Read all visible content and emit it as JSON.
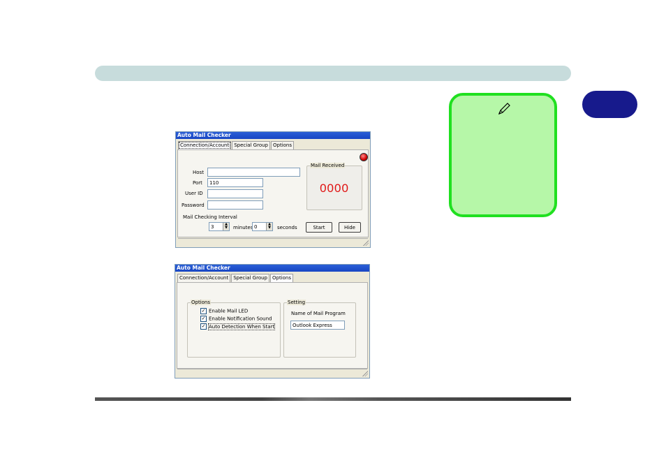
{
  "page": {
    "chapter_number": ""
  },
  "window1": {
    "title": "Auto Mail Checker",
    "tabs": [
      "Connection/Account",
      "Special Group",
      "Options"
    ],
    "host_label": "Host",
    "host_value": "",
    "port_label": "Port",
    "port_value": "110",
    "userid_label": "User ID",
    "userid_value": "",
    "password_label": "Password",
    "password_value": "",
    "mail_received_label": "Mail Received",
    "mail_count": "0000",
    "interval_label": "Mail Checking Interval",
    "minutes_value": "3",
    "minutes_label": "minutes",
    "seconds_value": "0",
    "seconds_label": "seconds",
    "start_button": "Start",
    "hide_button": "Hide"
  },
  "window2": {
    "title": "Auto Mail Checker",
    "tabs": [
      "Connection/Account",
      "Special Group",
      "Options"
    ],
    "options_group": "Options",
    "options": [
      {
        "label": "Enable Mail LED",
        "checked": true
      },
      {
        "label": "Enable Notification Sound",
        "checked": true
      },
      {
        "label": "Auto Detection When Start",
        "checked": true
      }
    ],
    "setting_group": "Setting",
    "mail_program_label": "Name of Mail Program",
    "mail_program_value": "Outlook Express"
  },
  "colors": {
    "header_bar": "#c7dcdc",
    "chapter_tab": "#171a8c",
    "note_fill": "#b6f7a8",
    "note_border": "#20e020",
    "counter_red": "#e01010"
  },
  "icons": {
    "note": "pencil-icon",
    "led": "red-led-icon"
  }
}
